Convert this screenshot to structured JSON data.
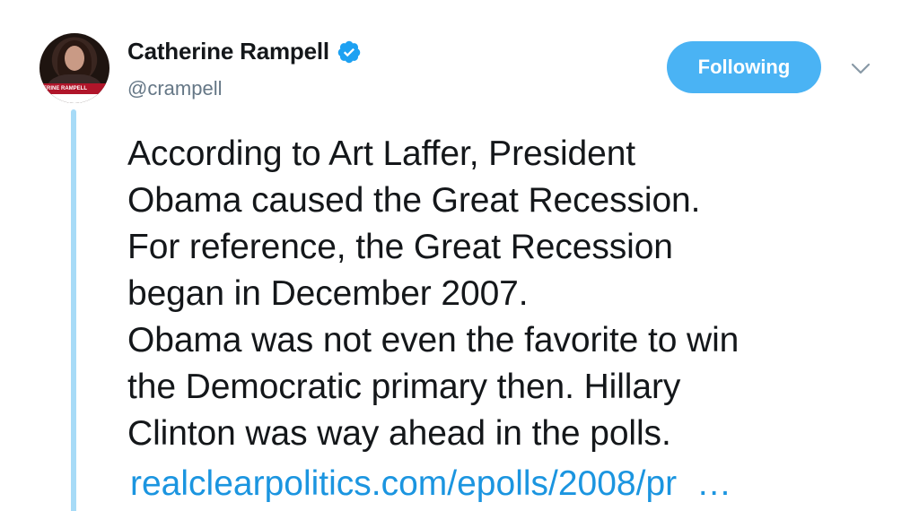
{
  "author": {
    "display_name": "Catherine Rampell",
    "handle": "@crampell",
    "avatar_banner_text": "ERINE RAMPELL",
    "verified": true
  },
  "follow_button": {
    "label": "Following"
  },
  "tweet": {
    "text": "According to Art Laffer, President\nObama caused the Great Recession.\nFor reference, the Great Recession\nbegan in December 2007.\nObama was not even the favorite to win\nthe Democratic primary then. Hillary\nClinton was way ahead in the polls.",
    "link_text": "realclearpolitics.com/epolls/2008/pr",
    "link_ellipsis": "…"
  },
  "colors": {
    "accent": "#1b95e0",
    "follow_bg": "#4ab3f4",
    "thread_line": "#a7dbf7",
    "text": "#14171a",
    "muted": "#657786"
  },
  "icons": {
    "verified": "verified-badge-icon",
    "caret": "chevron-down-icon"
  }
}
